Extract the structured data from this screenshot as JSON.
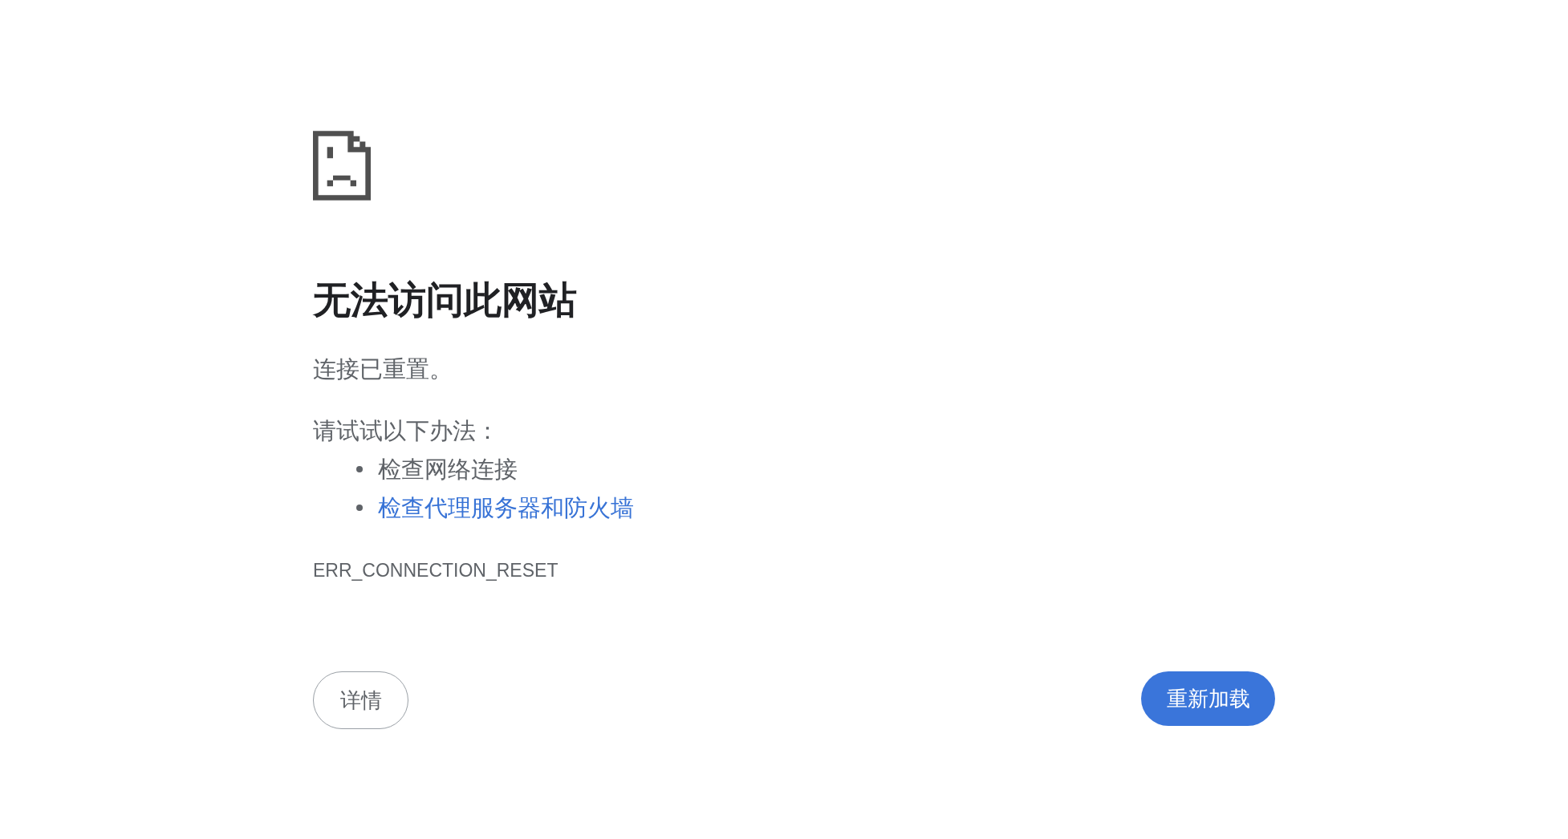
{
  "error_page": {
    "title": "无法访问此网站",
    "message": "连接已重置。",
    "suggestions_heading": "请试试以下办法：",
    "suggestions": [
      {
        "text": "检查网络连接",
        "kind": "text"
      },
      {
        "text": "检查代理服务器和防火墙",
        "kind": "link"
      }
    ],
    "error_code": "ERR_CONNECTION_RESET",
    "buttons": [
      {
        "label": "详情",
        "kind": "secondary"
      },
      {
        "label": "重新加载",
        "kind": "primary"
      }
    ]
  }
}
